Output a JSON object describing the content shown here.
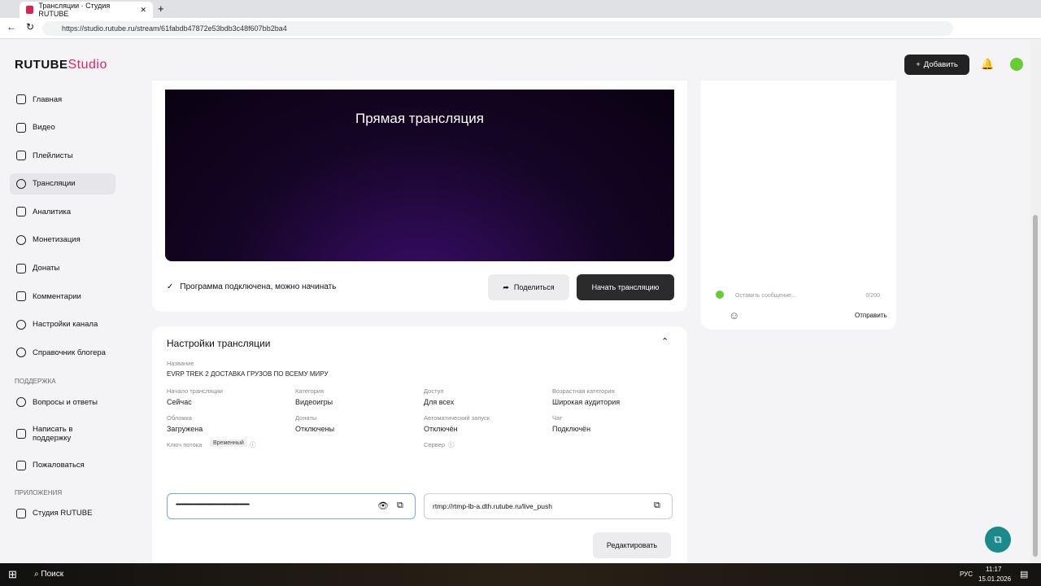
{
  "browser": {
    "tab_title": "Трансляции · Студия RUTUBE",
    "url": "https://studio.rutube.ru/stream/61fabdb47872e53bdb3c48f607bb2ba4"
  },
  "header": {
    "logo": "RUTUBE",
    "logo_suffix": "Studio",
    "add_label": "Добавить"
  },
  "sidebar": {
    "items": [
      {
        "label": "Главная"
      },
      {
        "label": "Видео"
      },
      {
        "label": "Плейлисты"
      },
      {
        "label": "Трансляции",
        "active": true
      },
      {
        "label": "Аналитика"
      },
      {
        "label": "Монетизация"
      },
      {
        "label": "Донаты"
      },
      {
        "label": "Комментарии"
      },
      {
        "label": "Настройки канала"
      },
      {
        "label": "Справочник блогера"
      }
    ],
    "support_title": "ПОДДЕРЖКА",
    "support": [
      {
        "label": "Вопросы и ответы"
      },
      {
        "label": "Написать в поддержку"
      },
      {
        "label": "Пожаловаться"
      }
    ],
    "apps_title": "ПРИЛОЖЕНИЯ",
    "apps": [
      {
        "label": "Студия RUTUBE"
      }
    ]
  },
  "player": {
    "title": "Прямая трансляция",
    "status": "Программа подключена, можно начинать",
    "share_label": "Поделиться",
    "start_label": "Начать трансляцию"
  },
  "chat": {
    "placeholder": "Оставить сообщение...",
    "counter": "0/200",
    "send_label": "Отправить"
  },
  "settings": {
    "title": "Настройки трансляции",
    "name_label": "Название",
    "name": "EVRP TREK 2 ДОСТАВКА ГРУЗОВ ПО ВСЕМУ МИРУ",
    "fields": [
      {
        "label": "Начало трансляции",
        "value": "Сейчас"
      },
      {
        "label": "Категория",
        "value": "Видеоигры"
      },
      {
        "label": "Доступ",
        "value": "Для всех"
      },
      {
        "label": "Возрастная категория",
        "value": "Широкая аудитория"
      },
      {
        "label": "Обложка",
        "value": "Загружена"
      },
      {
        "label": "Донаты",
        "value": "Отключены"
      },
      {
        "label": "Автоматический запуск",
        "value": "Отключён"
      },
      {
        "label": "Чат",
        "value": "Подключён"
      }
    ],
    "key_label": "Ключ потока",
    "key_badge": "Временный",
    "key_value": "••••••••••••••••••••••••••••••••••••••••••••••••••••••••••••••",
    "server_label": "Сервер",
    "server_value": "rtmp://rtmp-lb-a.dth.rutube.ru/live_push",
    "edit_label": "Редактировать"
  },
  "taskbar": {
    "search": "Поиск",
    "lang": "РУС",
    "time": "11:17",
    "date": "15.01.2026"
  },
  "colors": {
    "brand": "#e0245e",
    "dark_button": "#222222"
  }
}
